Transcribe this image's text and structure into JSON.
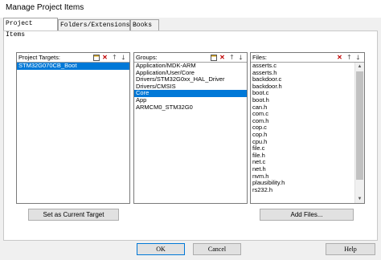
{
  "window": {
    "title": "Manage Project Items"
  },
  "tabs": [
    {
      "label": "Project Items"
    },
    {
      "label": "Folders/Extensions"
    },
    {
      "label": "Books"
    }
  ],
  "project_targets": {
    "header": "Project Targets:",
    "items": [
      "STM32G070CB_Boot"
    ],
    "selected_index": 0
  },
  "groups": {
    "header": "Groups:",
    "items": [
      "Application/MDK-ARM",
      "Application/User/Core",
      "Drivers/STM32G0xx_HAL_Driver",
      "Drivers/CMSIS",
      "Core",
      "App",
      "ARMCM0_STM32G0"
    ],
    "selected_index": 4
  },
  "files": {
    "header": "Files:",
    "items": [
      "asserts.c",
      "asserts.h",
      "backdoor.c",
      "backdoor.h",
      "boot.c",
      "boot.h",
      "can.h",
      "com.c",
      "com.h",
      "cop.c",
      "cop.h",
      "cpu.h",
      "file.c",
      "file.h",
      "net.c",
      "net.h",
      "nvm.h",
      "plausibility.h",
      "rs232.h"
    ]
  },
  "toolbar_icons": {
    "new": "new-icon",
    "delete": "delete-icon",
    "move_up": "arrow-up-icon",
    "move_down": "arrow-down-icon"
  },
  "buttons": {
    "set_target": "Set as Current Target",
    "add_files": "Add Files...",
    "ok": "OK",
    "cancel": "Cancel",
    "help": "Help"
  },
  "colors": {
    "selection": "#0078d7",
    "delete": "#c00000"
  }
}
